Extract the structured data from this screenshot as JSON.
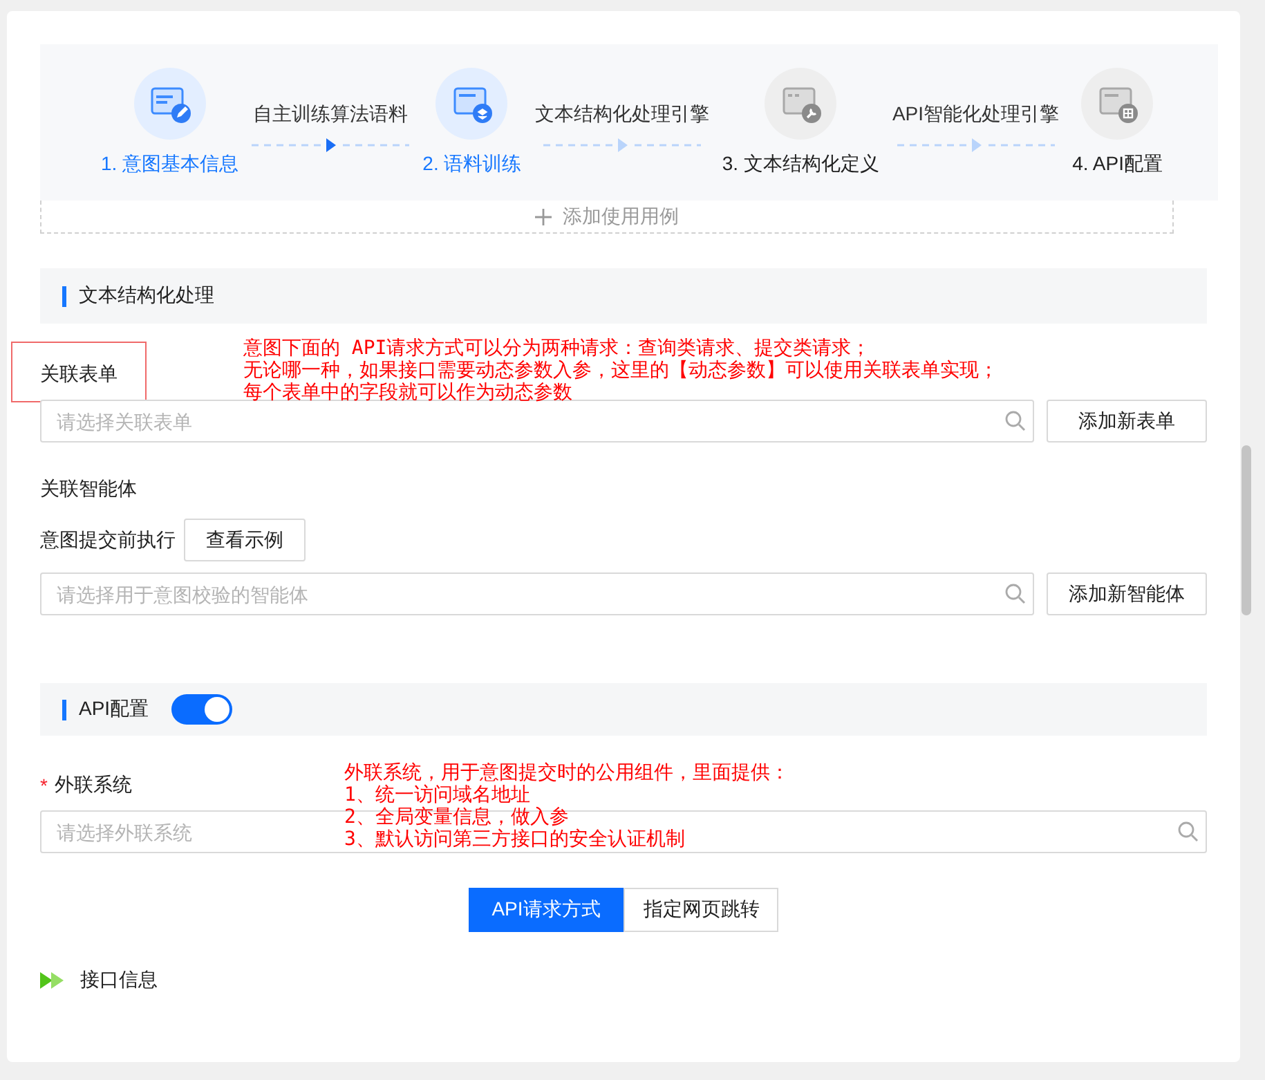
{
  "steps": [
    {
      "label": "1. 意图基本信息",
      "active": true,
      "kind": "edit"
    },
    {
      "label": "2. 语料训练",
      "active": true,
      "kind": "layers"
    },
    {
      "label": "3. 文本结构化定义",
      "active": false,
      "kind": "wrench"
    },
    {
      "label": "4. API配置",
      "active": false,
      "kind": "grid"
    }
  ],
  "connectors": [
    {
      "label": "自主训练算法语料",
      "active": true
    },
    {
      "label": "文本结构化处理引擎",
      "active": false
    },
    {
      "label": "API智能化处理引擎",
      "active": false
    }
  ],
  "add_example": {
    "label": "添加使用用例"
  },
  "form_section": {
    "title": "文本结构化处理"
  },
  "related_form": {
    "label": "关联表单",
    "highlighted": true,
    "placeholder": "请选择关联表单",
    "button": "添加新表单",
    "annotation": [
      "意图下面的 API请求方式可以分为两种请求：查询类请求、提交类请求；",
      "无论哪一种，如果接口需要动态参数入参，这里的【动态参数】可以使用关联表单实现；",
      "每个表单中的字段就可以作为动态参数"
    ]
  },
  "related_agent": {
    "label": "关联智能体",
    "pre_submit_label": "意图提交前执行",
    "example_button": "查看示例",
    "placeholder": "请选择用于意图校验的智能体",
    "button": "添加新智能体"
  },
  "api_section": {
    "title": "API配置",
    "on": true
  },
  "external_system": {
    "label": "外联系统",
    "required_mark": "*",
    "placeholder": "请选择外联系统",
    "annotation": [
      "外联系统，用于意图提交时的公用组件，里面提供：",
      "1、统一访问域名地址",
      "2、全局变量信息，做入参",
      "3、默认访问第三方接口的安全认证机制"
    ]
  },
  "mode_tabs": [
    {
      "label": "API请求方式",
      "selected": true
    },
    {
      "label": "指定网页跳转",
      "selected": false
    }
  ],
  "interface_info": {
    "label": "接口信息"
  }
}
